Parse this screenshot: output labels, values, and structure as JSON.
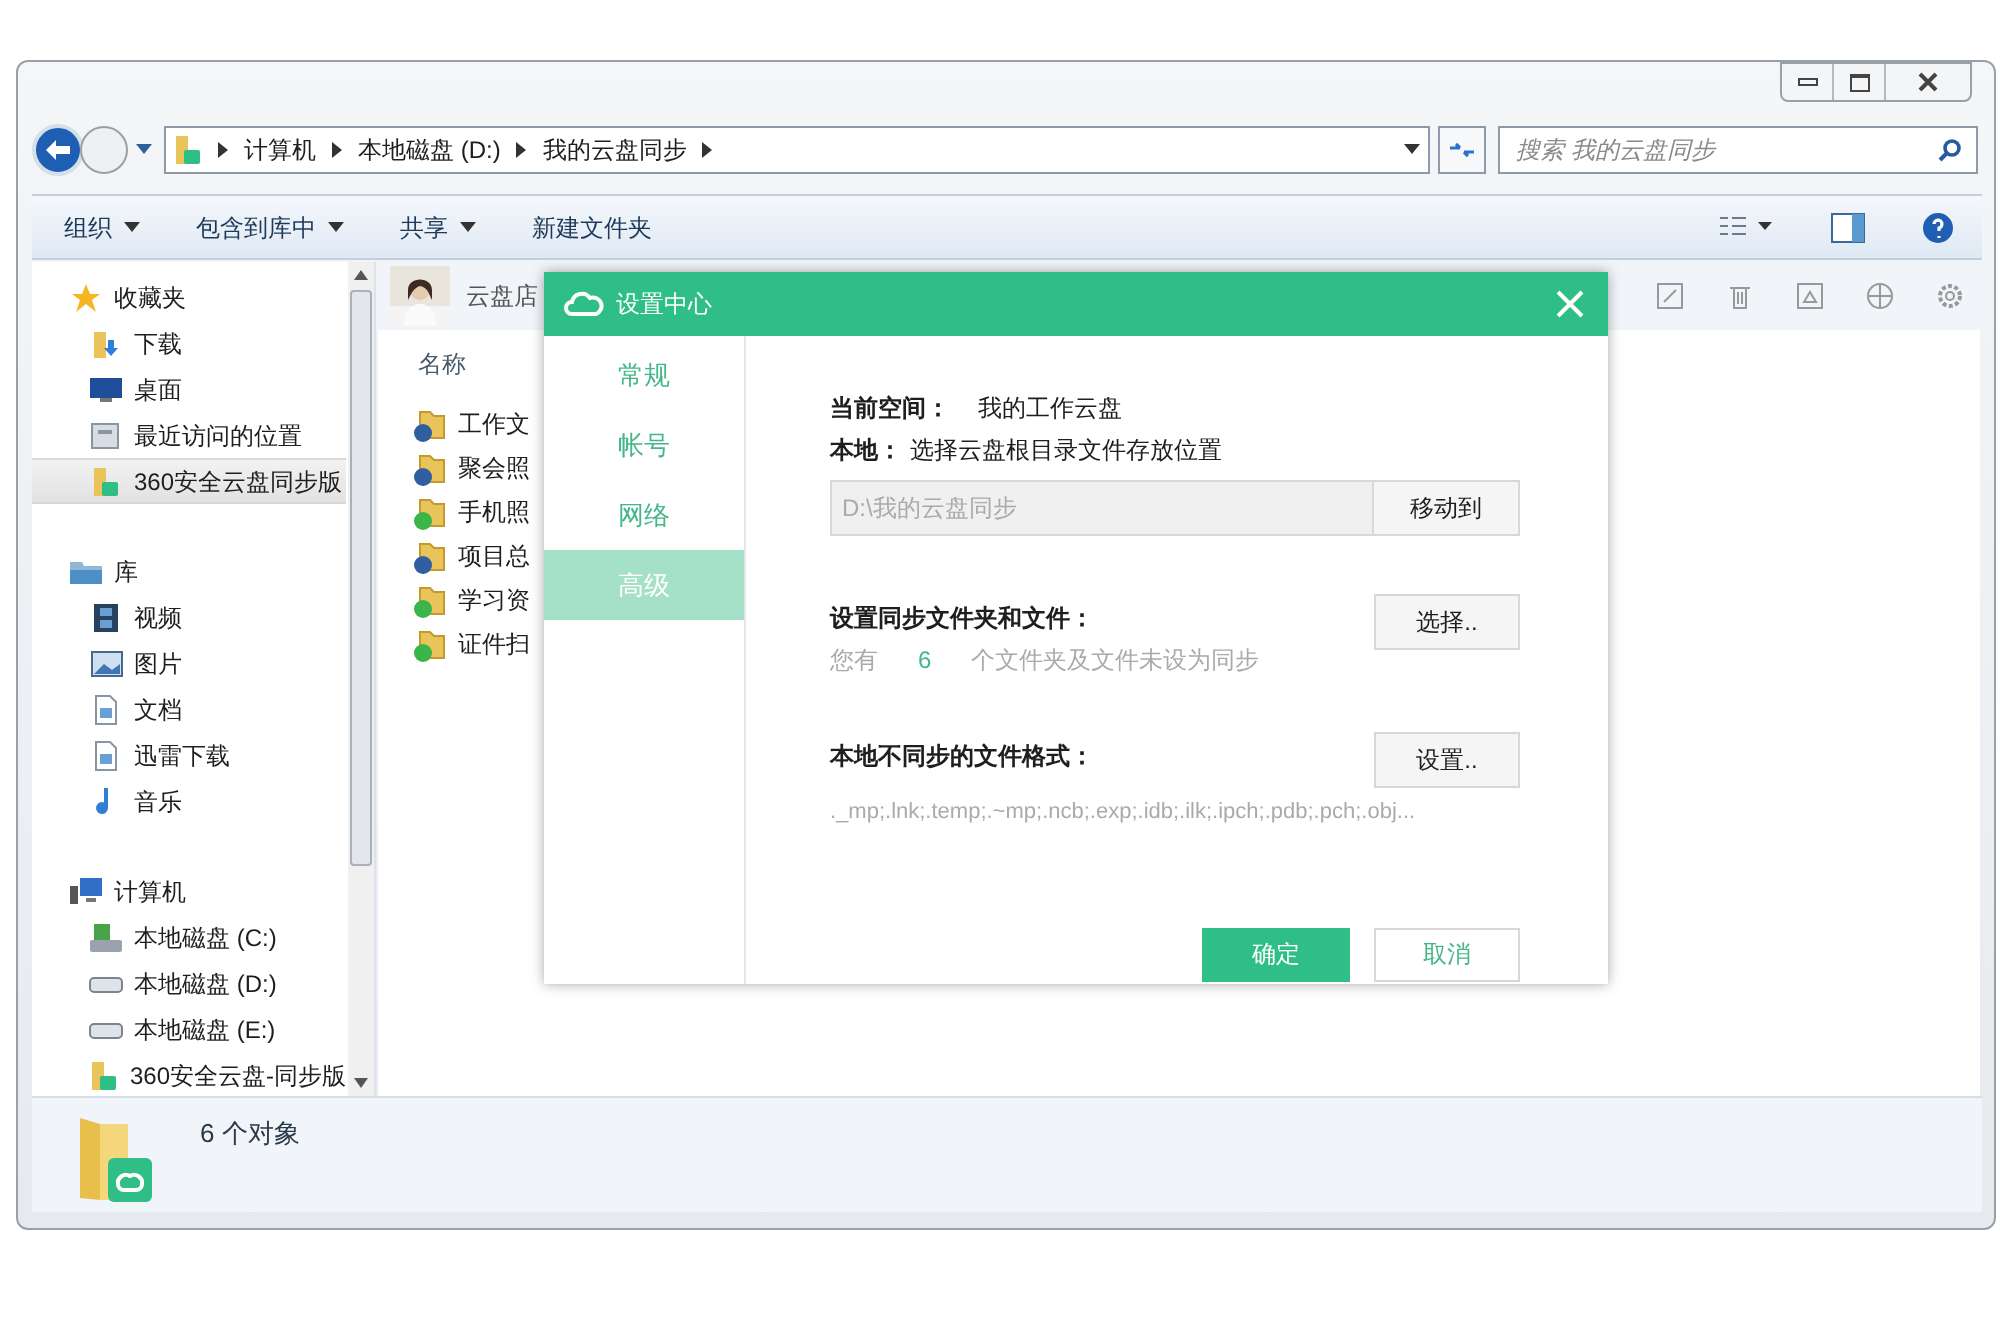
{
  "breadcrumb": [
    "计算机",
    "本地磁盘 (D:)",
    "我的云盘同步"
  ],
  "search": {
    "placeholder": "搜索 我的云盘同步"
  },
  "toolbar": [
    {
      "label": "组织",
      "menu": true
    },
    {
      "label": "包含到库中",
      "menu": true
    },
    {
      "label": "共享",
      "menu": true
    },
    {
      "label": "新建文件夹",
      "menu": false
    }
  ],
  "nav": [
    {
      "label": "收藏夹",
      "kind": "star",
      "children": [
        {
          "label": "下载",
          "kind": "download",
          "selected": false
        },
        {
          "label": "桌面",
          "kind": "desktop",
          "selected": false
        },
        {
          "label": "最近访问的位置",
          "kind": "recent",
          "selected": false
        },
        {
          "label": "360安全云盘同步版",
          "kind": "cloud",
          "selected": true
        }
      ]
    },
    {
      "label": "库",
      "kind": "library",
      "children": [
        {
          "label": "视频",
          "kind": "video",
          "selected": false
        },
        {
          "label": "图片",
          "selected": false
        },
        {
          "label": "文档",
          "kind": "doc",
          "selected": false
        },
        {
          "label": "迅雷下载",
          "kind": "doc",
          "selected": false
        },
        {
          "label": "音乐",
          "kind": "music",
          "selected": false
        }
      ]
    },
    {
      "label": "计算机",
      "kind": "computer",
      "children": [
        {
          "label": "本地磁盘 (C:)",
          "kind": "sysdrive",
          "selected": false
        },
        {
          "label": "本地磁盘 (D:)",
          "kind": "drive",
          "selected": false
        },
        {
          "label": "本地磁盘 (E:)",
          "kind": "drive",
          "selected": false
        },
        {
          "label": "360安全云盘-同步版",
          "kind": "cloud",
          "selected": false
        }
      ]
    }
  ],
  "account": {
    "name": "云盘店"
  },
  "file_list": {
    "column": "名称",
    "files": [
      {
        "name": "工作文",
        "synced": false
      },
      {
        "name": "聚会照",
        "synced": false
      },
      {
        "name": "手机照",
        "synced": true
      },
      {
        "name": "项目总",
        "synced": false
      },
      {
        "name": "学习资",
        "synced": true
      },
      {
        "name": "证件扫",
        "synced": true
      }
    ]
  },
  "status_bar": {
    "count": "6 个对象"
  },
  "dialog": {
    "title": "设置中心",
    "tabs": [
      {
        "label": "常规",
        "selected": false
      },
      {
        "label": "帐号",
        "selected": false
      },
      {
        "label": "网络",
        "selected": false
      },
      {
        "label": "高级",
        "selected": true
      }
    ],
    "space_label": "当前空间：",
    "space_value": "我的工作云盘",
    "local_label": "本地：",
    "local_value": "选择云盘根目录文件存放位置",
    "path": "D:\\我的云盘同步",
    "move_button": "移动到",
    "sync_title": "设置同步文件夹和文件：",
    "sync_prefix": "您有",
    "sync_count": "6",
    "sync_suffix": "个文件夹及文件未设为同步",
    "choose_button": "选择..",
    "format_title": "本地不同步的文件格式：",
    "format_button": "设置..",
    "formats": "._mp;.lnk;.temp;.~mp;.ncb;.exp;.idb;.ilk;.ipch;.pdb;.pch;.obj...",
    "ok": "确定",
    "cancel": "取消"
  }
}
